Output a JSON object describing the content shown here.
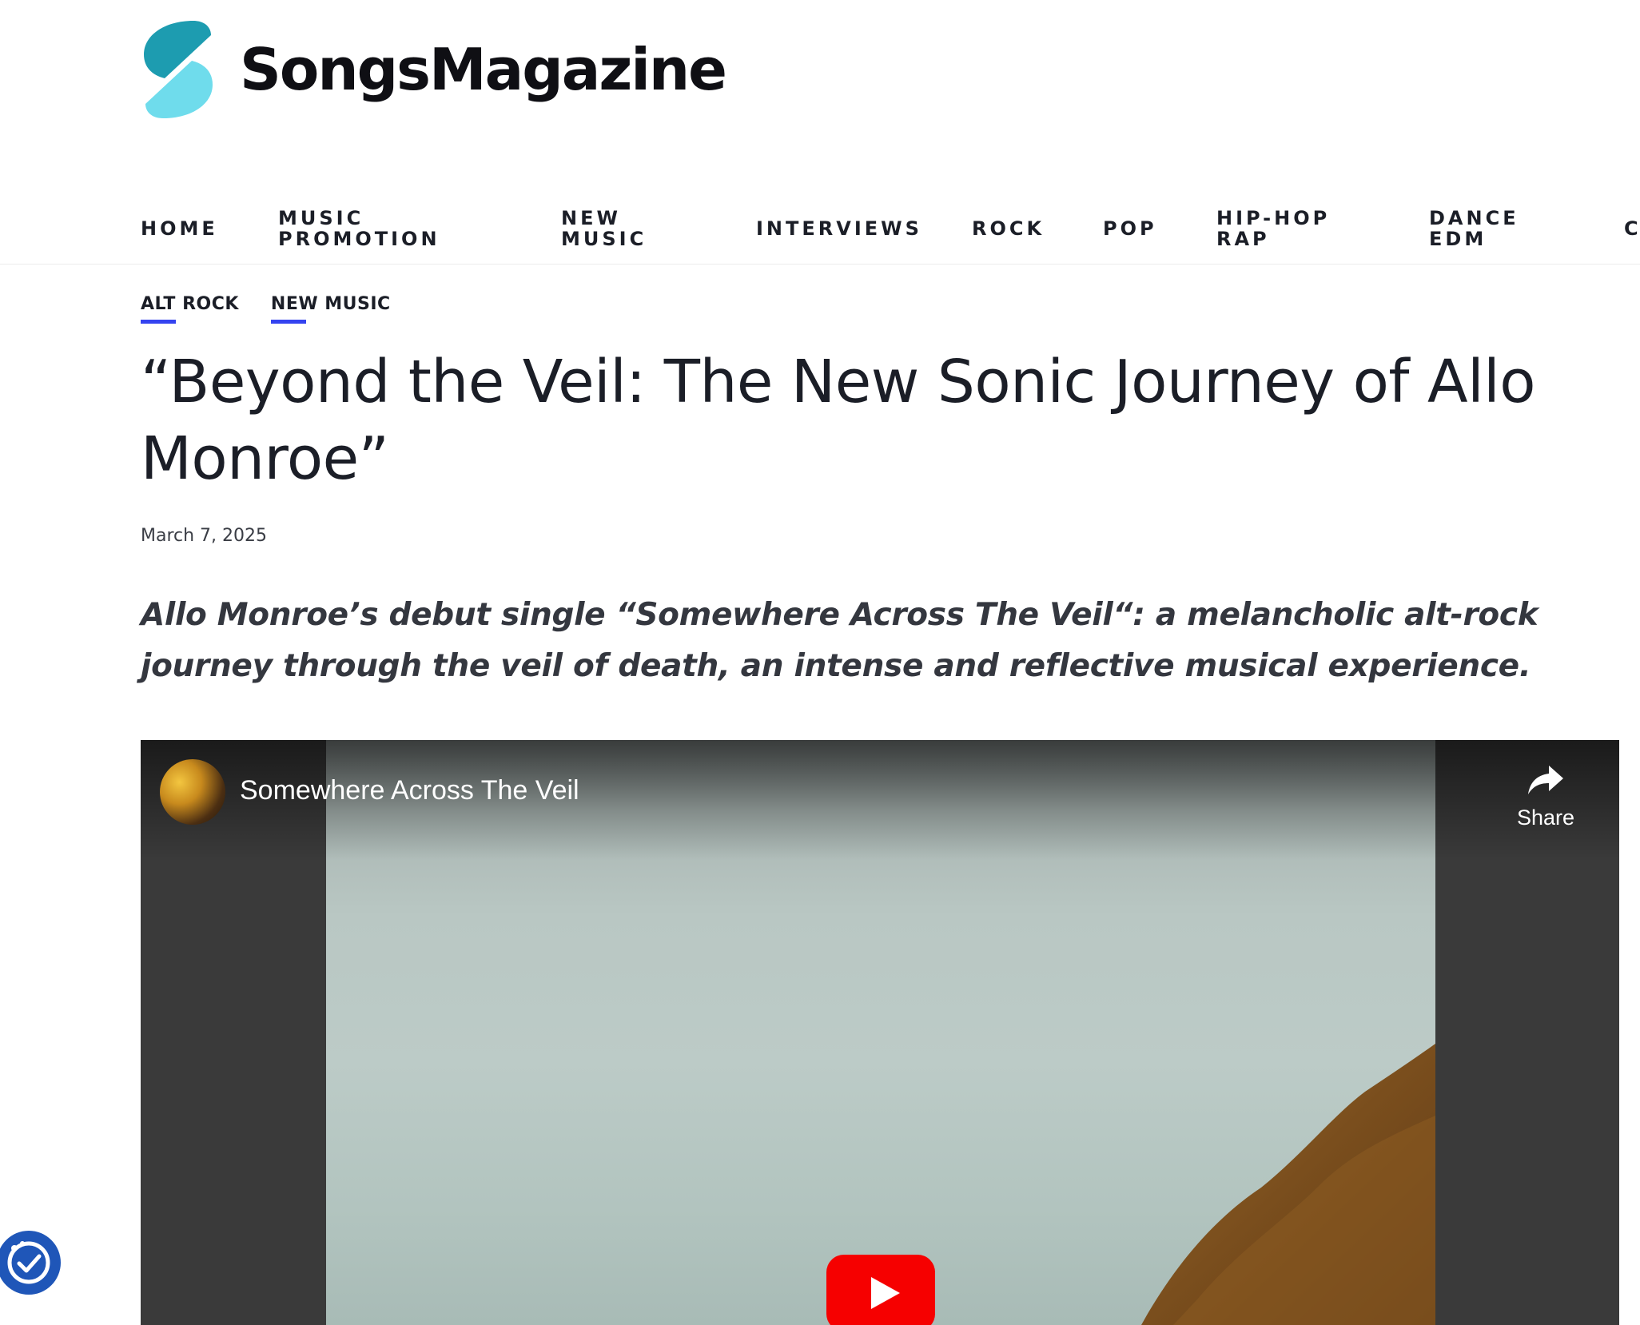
{
  "site": {
    "name": "SongsMagazine"
  },
  "nav": {
    "items": [
      {
        "label": "HOME"
      },
      {
        "label": "MUSIC\nPROMOTION"
      },
      {
        "label": "NEW\nMUSIC"
      },
      {
        "label": "INTERVIEWS"
      },
      {
        "label": "ROCK"
      },
      {
        "label": "POP"
      },
      {
        "label": "HIP-HOP\nRAP"
      },
      {
        "label": "DANCE\nEDM"
      },
      {
        "label": "C"
      }
    ]
  },
  "article": {
    "categories": [
      "ALT ROCK",
      "NEW MUSIC"
    ],
    "title": "“Beyond the Veil: The New Sonic Journey of Allo Monroe”",
    "date": "March 7, 2025",
    "lede": "Allo Monroe’s debut single “Somewhere Across The Veil“: a melancholic alt-rock journey through the veil of death, an intense and reflective musical experience."
  },
  "video": {
    "title": "Somewhere Across The Veil",
    "share_label": "Share",
    "play_icon": "youtube-play-icon",
    "play_color": "#f60000"
  },
  "colors": {
    "accent": "#3443f0",
    "logo_dark": "#1d9cb0",
    "logo_light": "#6fdcec",
    "a11y": "#1f56b8"
  }
}
